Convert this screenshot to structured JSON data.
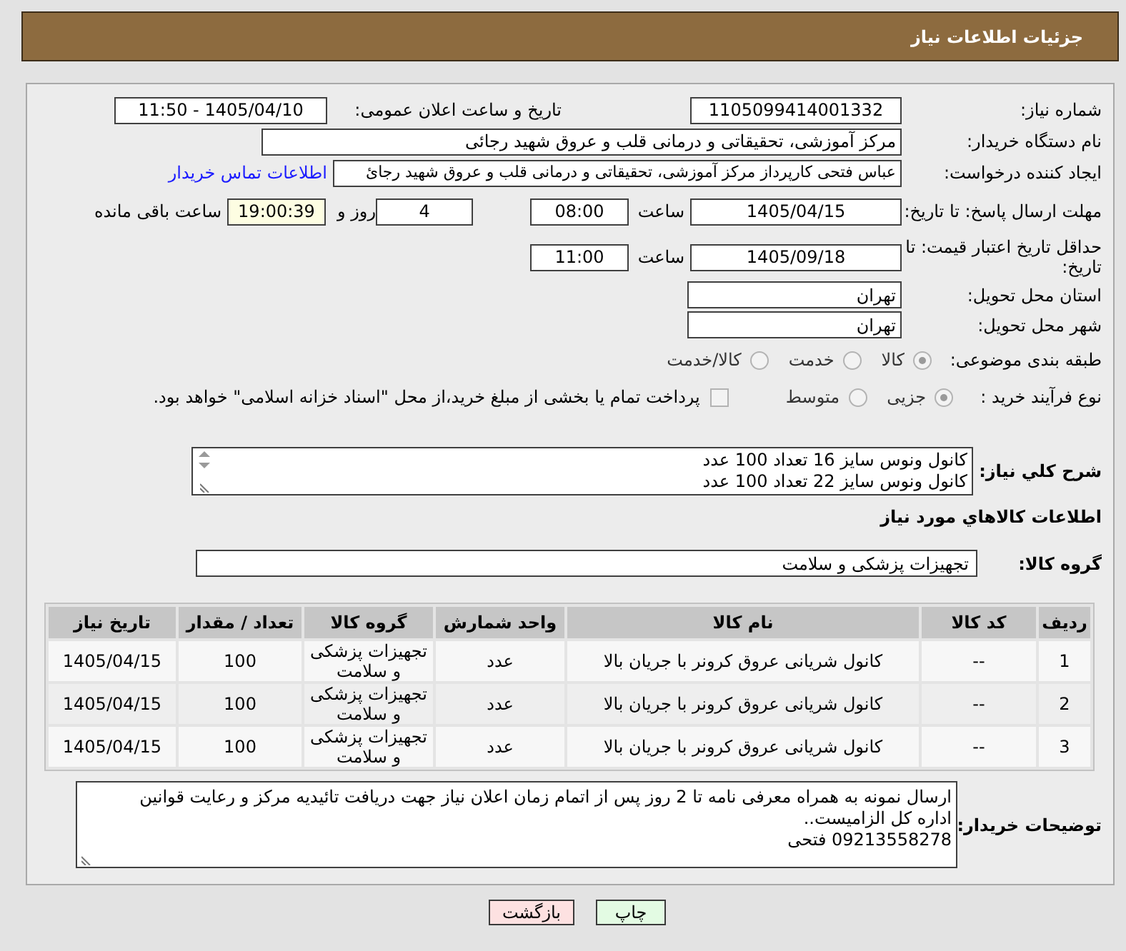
{
  "header": {
    "title": "جزئیات اطلاعات نیاز"
  },
  "need_number": {
    "label": "شماره نیاز:",
    "value": "1105099414001332"
  },
  "announce_datetime": {
    "label": "تاریخ و ساعت اعلان عمومی:",
    "value": "1405/04/10 - 11:50"
  },
  "buyer_org": {
    "label": "نام دستگاه خریدار:",
    "value": "مرکز آموزشی، تحقیقاتی و درمانی قلب و عروق شهید رجائی"
  },
  "requester": {
    "label": "ایجاد کننده درخواست:",
    "value": "عباس فتحی کارپرداز مرکز آموزشی، تحقیقاتی و درمانی قلب و عروق شهید رجائ",
    "link": "اطلاعات تماس خریدار"
  },
  "reply_deadline": {
    "label": "مهلت ارسال پاسخ: تا تاریخ:",
    "date": "1405/04/15",
    "time_label": "ساعت",
    "time": "08:00",
    "days": "4",
    "days_label": "روز و",
    "remaining": "19:00:39",
    "remaining_label": "ساعت باقی مانده"
  },
  "price_validity": {
    "label": "حداقل تاریخ اعتبار قیمت: تا تاریخ:",
    "date": "1405/09/18",
    "time_label": "ساعت",
    "time": "11:00"
  },
  "province": {
    "label": "استان محل تحویل:",
    "value": "تهران"
  },
  "city": {
    "label": "شهر محل تحویل:",
    "value": "تهران"
  },
  "category": {
    "label": "طبقه بندی موضوعی:",
    "options": [
      {
        "label": "کالا",
        "selected": true
      },
      {
        "label": "خدمت",
        "selected": false
      },
      {
        "label": "کالا/خدمت",
        "selected": false
      }
    ]
  },
  "process": {
    "label": "نوع فرآیند خرید :",
    "options": [
      {
        "label": "جزیی",
        "selected": true
      },
      {
        "label": "متوسط",
        "selected": false
      }
    ],
    "treasury": {
      "label": "پرداخت تمام یا بخشی از مبلغ خرید،از محل \"اسناد خزانه اسلامی\" خواهد بود.",
      "checked": false
    }
  },
  "description": {
    "label": "شرح کلي نياز:",
    "lines": [
      "کانول ونوس سایز 16 تعداد 100 عدد",
      "کانول ونوس سایز 22 تعداد 100 عدد"
    ]
  },
  "goods_section": {
    "title": "اطلاعات کالاهاي مورد نياز"
  },
  "goods_group": {
    "label": "گروه کالا:",
    "value": "تجهیزات پزشکی و سلامت"
  },
  "table": {
    "columns": [
      "ردیف",
      "کد کالا",
      "نام کالا",
      "واحد شمارش",
      "گروه کالا",
      "تعداد / مقدار",
      "تاریخ نیاز"
    ],
    "rows": [
      [
        "1",
        "--",
        "کانول شریانی عروق کرونر با جریان بالا",
        "عدد",
        "تجهیزات پزشکی و سلامت",
        "100",
        "1405/04/15"
      ],
      [
        "2",
        "--",
        "کانول شریانی عروق کرونر با جریان بالا",
        "عدد",
        "تجهیزات پزشکی و سلامت",
        "100",
        "1405/04/15"
      ],
      [
        "3",
        "--",
        "کانول شریانی عروق کرونر با جریان بالا",
        "عدد",
        "تجهیزات پزشکی و سلامت",
        "100",
        "1405/04/15"
      ]
    ]
  },
  "buyer_notes": {
    "label": "توضیحات خریدار:",
    "lines": [
      "ارسال نمونه به همراه معرفی نامه تا 2 روز پس از اتمام زمان اعلان نیاز جهت دریافت تائیدیه مرکز و رعایت قوانین اداره کل الزامیست..",
      "09213558278 فتحی"
    ]
  },
  "buttons": [
    {
      "label": "چاپ",
      "kind": "print"
    },
    {
      "label": "بازگشت",
      "kind": "back"
    }
  ]
}
